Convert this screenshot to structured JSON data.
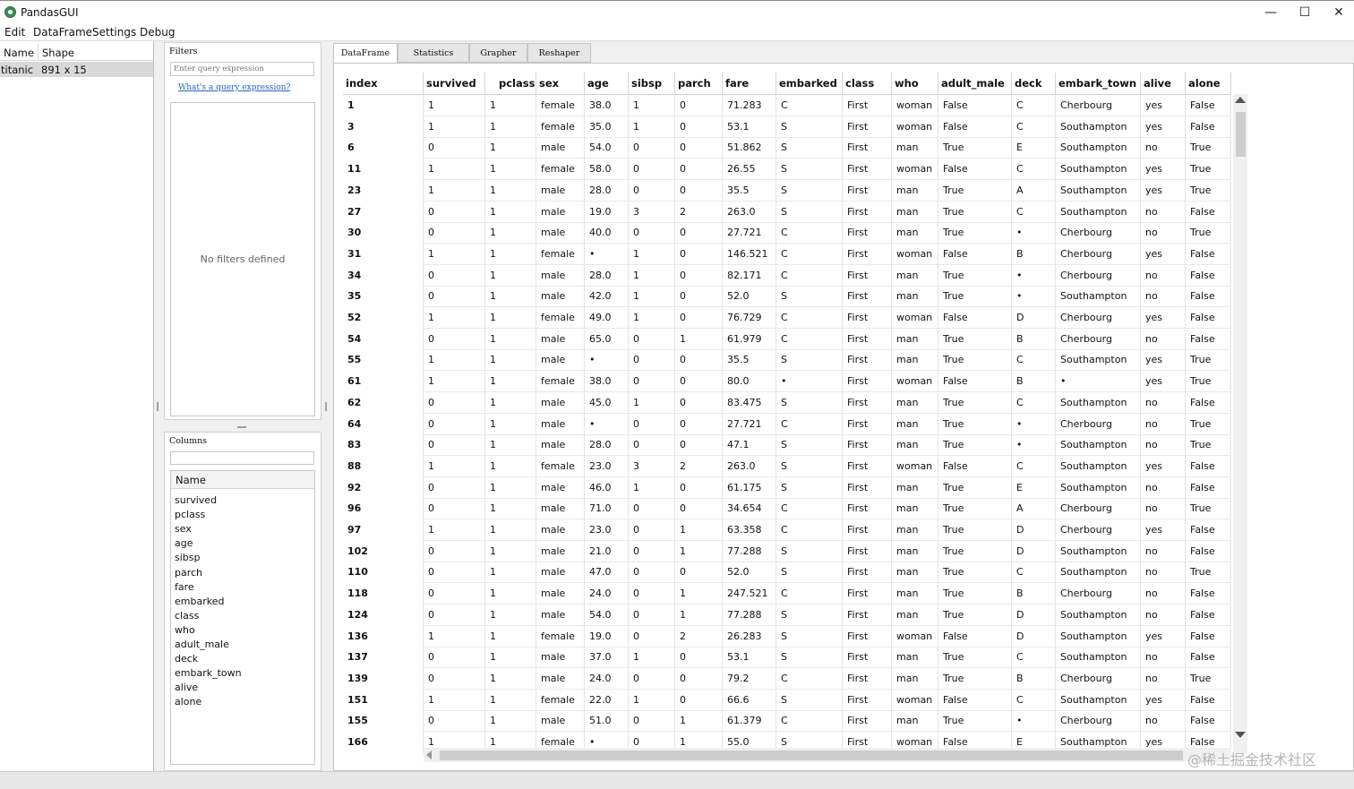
{
  "window": {
    "title": "PandasGUI",
    "minimize_glyph": "—",
    "maximize_glyph": "☐",
    "close_glyph": "✕"
  },
  "menu": [
    "Edit",
    "DataFrame",
    "Settings",
    "Debug"
  ],
  "dataframes": {
    "headers": [
      "Name",
      "Shape"
    ],
    "rows": [
      {
        "name": "titanic",
        "shape": "891 x 15"
      }
    ]
  },
  "filters": {
    "title": "Filters",
    "placeholder": "Enter query expression",
    "link": "What's a query expression?",
    "empty_text": "No filters defined"
  },
  "columns_panel": {
    "title": "Columns",
    "header": "Name",
    "items": [
      "survived",
      "pclass",
      "sex",
      "age",
      "sibsp",
      "parch",
      "fare",
      "embarked",
      "class",
      "who",
      "adult_male",
      "deck",
      "embark_town",
      "alive",
      "alone"
    ]
  },
  "tabs": [
    "DataFrame",
    "Statistics",
    "Grapher",
    "Reshaper"
  ],
  "table": {
    "columns": [
      "index",
      "survived",
      "pclass",
      "sex",
      "age",
      "sibsp",
      "parch",
      "fare",
      "embarked",
      "class",
      "who",
      "adult_male",
      "deck",
      "embark_town",
      "alive",
      "alone"
    ],
    "rows": [
      [
        "1",
        "1",
        "1",
        "female",
        "38.0",
        "1",
        "0",
        "71.283",
        "C",
        "First",
        "woman",
        "False",
        "C",
        "Cherbourg",
        "yes",
        "False"
      ],
      [
        "3",
        "1",
        "1",
        "female",
        "35.0",
        "1",
        "0",
        "53.1",
        "S",
        "First",
        "woman",
        "False",
        "C",
        "Southampton",
        "yes",
        "False"
      ],
      [
        "6",
        "0",
        "1",
        "male",
        "54.0",
        "0",
        "0",
        "51.862",
        "S",
        "First",
        "man",
        "True",
        "E",
        "Southampton",
        "no",
        "True"
      ],
      [
        "11",
        "1",
        "1",
        "female",
        "58.0",
        "0",
        "0",
        "26.55",
        "S",
        "First",
        "woman",
        "False",
        "C",
        "Southampton",
        "yes",
        "True"
      ],
      [
        "23",
        "1",
        "1",
        "male",
        "28.0",
        "0",
        "0",
        "35.5",
        "S",
        "First",
        "man",
        "True",
        "A",
        "Southampton",
        "yes",
        "True"
      ],
      [
        "27",
        "0",
        "1",
        "male",
        "19.0",
        "3",
        "2",
        "263.0",
        "S",
        "First",
        "man",
        "True",
        "C",
        "Southampton",
        "no",
        "False"
      ],
      [
        "30",
        "0",
        "1",
        "male",
        "40.0",
        "0",
        "0",
        "27.721",
        "C",
        "First",
        "man",
        "True",
        "•",
        "Cherbourg",
        "no",
        "True"
      ],
      [
        "31",
        "1",
        "1",
        "female",
        "•",
        "1",
        "0",
        "146.521",
        "C",
        "First",
        "woman",
        "False",
        "B",
        "Cherbourg",
        "yes",
        "False"
      ],
      [
        "34",
        "0",
        "1",
        "male",
        "28.0",
        "1",
        "0",
        "82.171",
        "C",
        "First",
        "man",
        "True",
        "•",
        "Cherbourg",
        "no",
        "False"
      ],
      [
        "35",
        "0",
        "1",
        "male",
        "42.0",
        "1",
        "0",
        "52.0",
        "S",
        "First",
        "man",
        "True",
        "•",
        "Southampton",
        "no",
        "False"
      ],
      [
        "52",
        "1",
        "1",
        "female",
        "49.0",
        "1",
        "0",
        "76.729",
        "C",
        "First",
        "woman",
        "False",
        "D",
        "Cherbourg",
        "yes",
        "False"
      ],
      [
        "54",
        "0",
        "1",
        "male",
        "65.0",
        "0",
        "1",
        "61.979",
        "C",
        "First",
        "man",
        "True",
        "B",
        "Cherbourg",
        "no",
        "False"
      ],
      [
        "55",
        "1",
        "1",
        "male",
        "•",
        "0",
        "0",
        "35.5",
        "S",
        "First",
        "man",
        "True",
        "C",
        "Southampton",
        "yes",
        "True"
      ],
      [
        "61",
        "1",
        "1",
        "female",
        "38.0",
        "0",
        "0",
        "80.0",
        "•",
        "First",
        "woman",
        "False",
        "B",
        "•",
        "yes",
        "True"
      ],
      [
        "62",
        "0",
        "1",
        "male",
        "45.0",
        "1",
        "0",
        "83.475",
        "S",
        "First",
        "man",
        "True",
        "C",
        "Southampton",
        "no",
        "False"
      ],
      [
        "64",
        "0",
        "1",
        "male",
        "•",
        "0",
        "0",
        "27.721",
        "C",
        "First",
        "man",
        "True",
        "•",
        "Cherbourg",
        "no",
        "True"
      ],
      [
        "83",
        "0",
        "1",
        "male",
        "28.0",
        "0",
        "0",
        "47.1",
        "S",
        "First",
        "man",
        "True",
        "•",
        "Southampton",
        "no",
        "True"
      ],
      [
        "88",
        "1",
        "1",
        "female",
        "23.0",
        "3",
        "2",
        "263.0",
        "S",
        "First",
        "woman",
        "False",
        "C",
        "Southampton",
        "yes",
        "False"
      ],
      [
        "92",
        "0",
        "1",
        "male",
        "46.0",
        "1",
        "0",
        "61.175",
        "S",
        "First",
        "man",
        "True",
        "E",
        "Southampton",
        "no",
        "False"
      ],
      [
        "96",
        "0",
        "1",
        "male",
        "71.0",
        "0",
        "0",
        "34.654",
        "C",
        "First",
        "man",
        "True",
        "A",
        "Cherbourg",
        "no",
        "True"
      ],
      [
        "97",
        "1",
        "1",
        "male",
        "23.0",
        "0",
        "1",
        "63.358",
        "C",
        "First",
        "man",
        "True",
        "D",
        "Cherbourg",
        "yes",
        "False"
      ],
      [
        "102",
        "0",
        "1",
        "male",
        "21.0",
        "0",
        "1",
        "77.288",
        "S",
        "First",
        "man",
        "True",
        "D",
        "Southampton",
        "no",
        "False"
      ],
      [
        "110",
        "0",
        "1",
        "male",
        "47.0",
        "0",
        "0",
        "52.0",
        "S",
        "First",
        "man",
        "True",
        "C",
        "Southampton",
        "no",
        "True"
      ],
      [
        "118",
        "0",
        "1",
        "male",
        "24.0",
        "0",
        "1",
        "247.521",
        "C",
        "First",
        "man",
        "True",
        "B",
        "Cherbourg",
        "no",
        "False"
      ],
      [
        "124",
        "0",
        "1",
        "male",
        "54.0",
        "0",
        "1",
        "77.288",
        "S",
        "First",
        "man",
        "True",
        "D",
        "Southampton",
        "no",
        "False"
      ],
      [
        "136",
        "1",
        "1",
        "female",
        "19.0",
        "0",
        "2",
        "26.283",
        "S",
        "First",
        "woman",
        "False",
        "D",
        "Southampton",
        "yes",
        "False"
      ],
      [
        "137",
        "0",
        "1",
        "male",
        "37.0",
        "1",
        "0",
        "53.1",
        "S",
        "First",
        "man",
        "True",
        "C",
        "Southampton",
        "no",
        "False"
      ],
      [
        "139",
        "0",
        "1",
        "male",
        "24.0",
        "0",
        "0",
        "79.2",
        "C",
        "First",
        "man",
        "True",
        "B",
        "Cherbourg",
        "no",
        "True"
      ],
      [
        "151",
        "1",
        "1",
        "female",
        "22.0",
        "1",
        "0",
        "66.6",
        "S",
        "First",
        "woman",
        "False",
        "C",
        "Southampton",
        "yes",
        "False"
      ],
      [
        "155",
        "0",
        "1",
        "male",
        "51.0",
        "0",
        "1",
        "61.379",
        "C",
        "First",
        "man",
        "True",
        "•",
        "Cherbourg",
        "no",
        "False"
      ],
      [
        "166",
        "1",
        "1",
        "female",
        "•",
        "0",
        "1",
        "55.0",
        "S",
        "First",
        "woman",
        "False",
        "E",
        "Southampton",
        "yes",
        "False"
      ]
    ]
  },
  "watermark": "@稀土掘金技术社区"
}
